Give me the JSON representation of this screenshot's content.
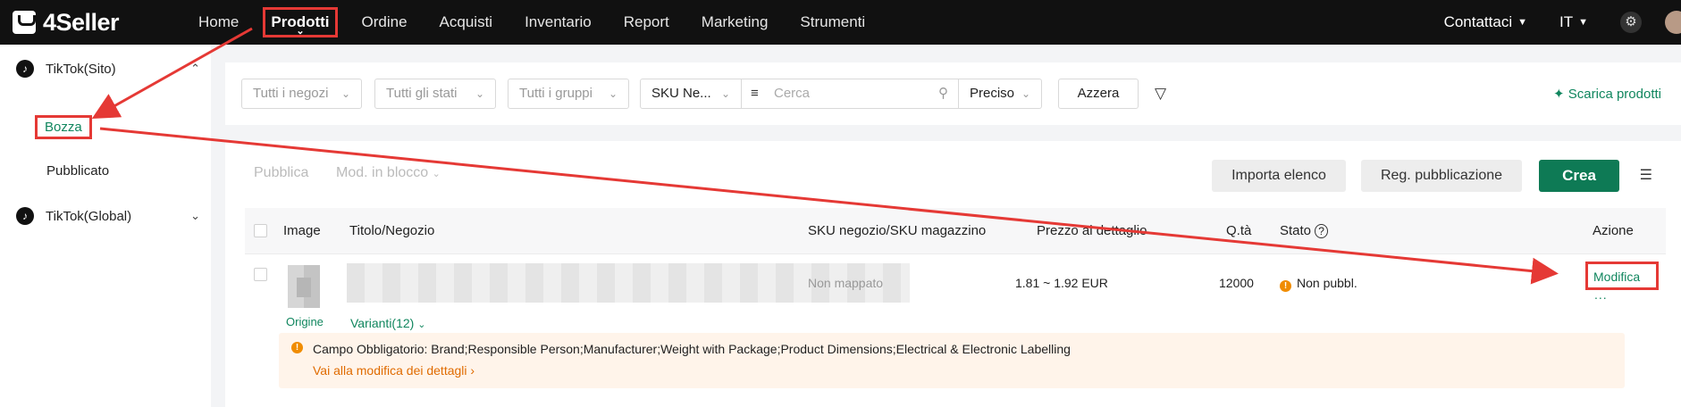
{
  "app": {
    "name": "4Seller"
  },
  "nav": {
    "items": [
      "Home",
      "Prodotti",
      "Ordine",
      "Acquisti",
      "Inventario",
      "Report",
      "Marketing",
      "Strumenti"
    ],
    "active": "Prodotti"
  },
  "topright": {
    "contact": "Contattaci",
    "lang": "IT"
  },
  "sidebar": {
    "group1": "TikTok(Sito)",
    "sub1": "Bozza",
    "sub2": "Pubblicato",
    "group2": "TikTok(Global)"
  },
  "filters": {
    "shops": "Tutti i negozi",
    "states": "Tutti gli stati",
    "groups": "Tutti i gruppi",
    "sku_type": "SKU Ne...",
    "search_placeholder": "Cerca",
    "match": "Preciso",
    "reset": "Azzera",
    "download": "Scarica prodotti"
  },
  "toolbar": {
    "publish": "Pubblica",
    "bulk_edit": "Mod. in blocco",
    "import": "Importa elenco",
    "log": "Reg. pubblicazione",
    "create": "Crea"
  },
  "table": {
    "headers": [
      "Image",
      "Titolo/Negozio",
      "SKU negozio/SKU magazzino",
      "Prezzo al dettaglio",
      "Q.tà",
      "Stato",
      "Azione"
    ],
    "row": {
      "origin": "Origine",
      "variants": "Varianti(12)",
      "sku": "Non mappato",
      "price": "1.81 ~ 1.92 EUR",
      "qty": "12000",
      "status": "Non pubbl.",
      "action": "Modifica",
      "more": "..."
    },
    "alert": {
      "text": "Campo Obbligatorio: Brand;Responsible Person;Manufacturer;Weight with Package;Product Dimensions;Electrical & Electronic Labelling",
      "link": "Vai alla modifica dei dettagli"
    }
  },
  "colors": {
    "accent": "#0e7a55",
    "highlight": "#e53935",
    "warning": "#f08c00"
  }
}
